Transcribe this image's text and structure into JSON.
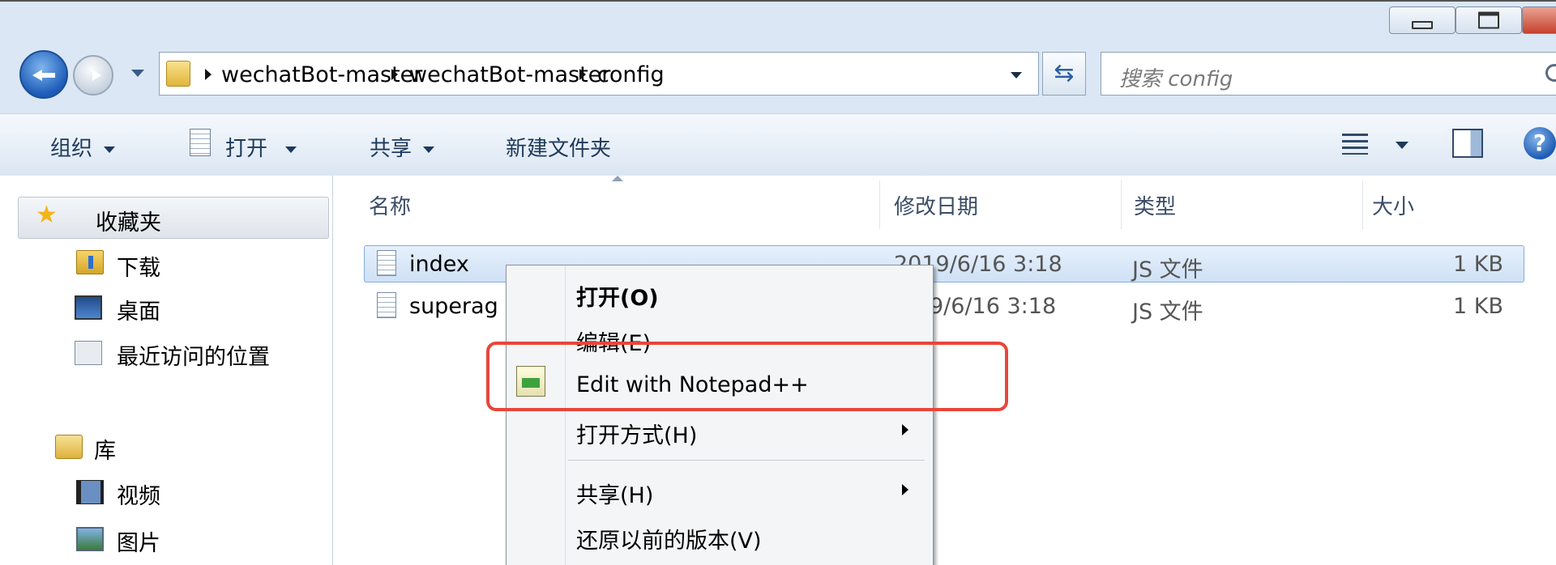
{
  "address": {
    "crumbs": [
      "wechatBot-master",
      "wechatBot-master",
      "config"
    ]
  },
  "search": {
    "placeholder": "搜索 config"
  },
  "toolbar": {
    "organize": "组织",
    "open": "打开",
    "share": "共享",
    "new_folder": "新建文件夹"
  },
  "sidebar": {
    "favorites_label": "收藏夹",
    "favorites": [
      "下载",
      "桌面",
      "最近访问的位置"
    ],
    "library_label": "库",
    "library": [
      "视频",
      "图片"
    ]
  },
  "columns": {
    "name": "名称",
    "modified": "修改日期",
    "type": "类型",
    "size": "大小"
  },
  "files": [
    {
      "name": "index",
      "modified": "2019/6/16 3:18",
      "type": "JS 文件",
      "size": "1 KB"
    },
    {
      "name": "superag",
      "modified": "9/6/16 3:18",
      "type": "JS 文件",
      "size": "1 KB"
    }
  ],
  "context_menu": {
    "items": [
      "打开(O)",
      "编辑(E)",
      "Edit with Notepad++",
      "打开方式(H)",
      "共享(H)",
      "还原以前的版本(V)"
    ]
  },
  "colors": {
    "highlight_box": "#e8463a",
    "selection": "#cfe1f6"
  }
}
